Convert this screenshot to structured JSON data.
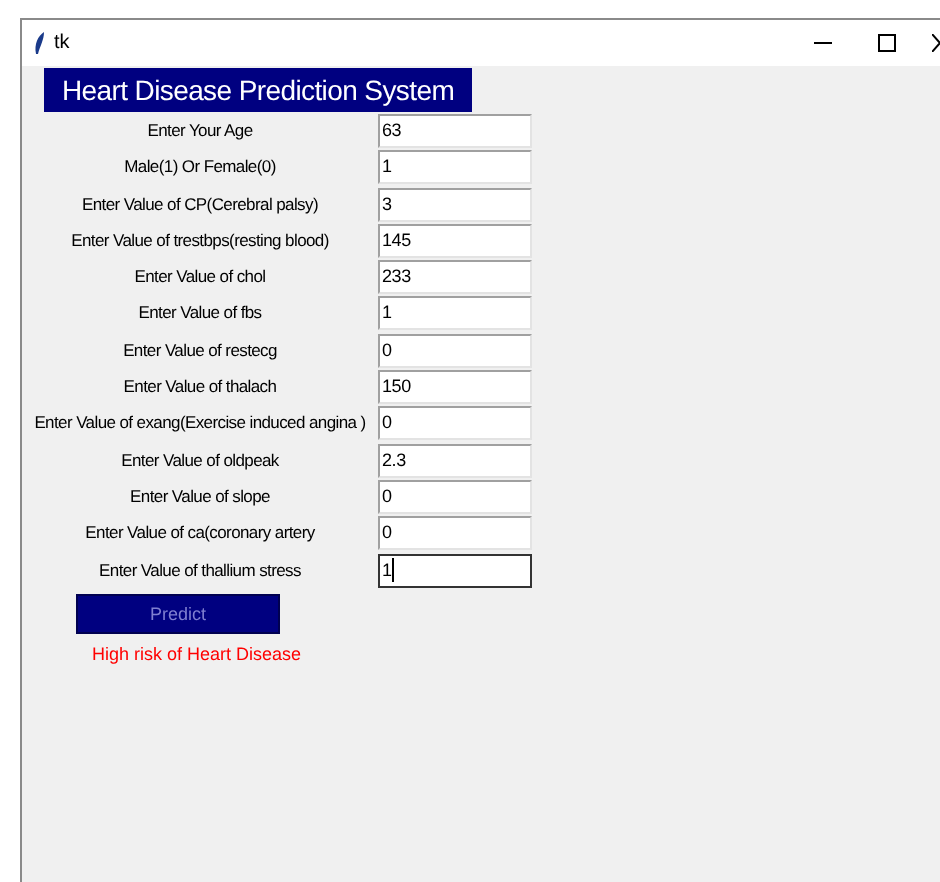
{
  "window": {
    "title": "tk"
  },
  "heading": "Heart Disease Prediction System",
  "fields": [
    {
      "label": "Enter Your Age",
      "value": "63",
      "focused": false
    },
    {
      "label": "Male(1) Or Female(0)",
      "value": "1",
      "focused": false
    },
    {
      "label": "Enter Value of CP(Cerebral palsy)",
      "value": "3",
      "focused": false
    },
    {
      "label": "Enter Value of trestbps(resting blood)",
      "value": "145",
      "focused": false
    },
    {
      "label": "Enter Value of chol",
      "value": "233",
      "focused": false
    },
    {
      "label": "Enter Value of fbs",
      "value": "1",
      "focused": false
    },
    {
      "label": "Enter Value of restecg",
      "value": "0",
      "focused": false
    },
    {
      "label": "Enter Value of thalach",
      "value": "150",
      "focused": false
    },
    {
      "label": "Enter Value of exang(Exercise induced angina )",
      "value": "0",
      "focused": false
    },
    {
      "label": "Enter Value of oldpeak",
      "value": "2.3",
      "focused": false
    },
    {
      "label": "Enter Value of slope",
      "value": "0",
      "focused": false
    },
    {
      "label": "Enter Value of ca(coronary artery",
      "value": "0",
      "focused": false
    },
    {
      "label": "Enter Value of thallium stress",
      "value": "1",
      "focused": true
    }
  ],
  "predict_button": {
    "label": "Predict"
  },
  "result": "High risk of Heart Disease"
}
